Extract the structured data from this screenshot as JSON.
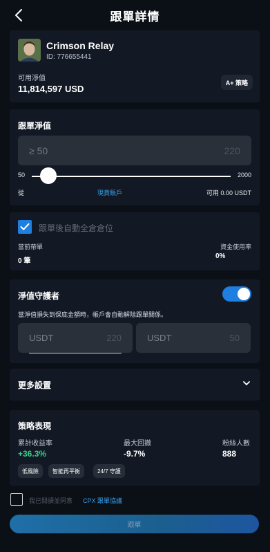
{
  "header": {
    "title": "跟單詳情"
  },
  "trader": {
    "name": "Crimson Relay",
    "id": "ID: 776655441",
    "equity_label": "可用淨值",
    "equity_value": "11,814,597 USD",
    "strategy_badge": "A+ 策略"
  },
  "copy_equity": {
    "title": "跟單淨值",
    "input_placeholder": "≥ 50",
    "input_max": "220",
    "slider_min": "50",
    "slider_max": "2000",
    "slider_value": 50,
    "from_label": "從",
    "spot_account": "現貨賬戶",
    "available": "可用 0.00 USDT"
  },
  "positions": {
    "auto_close_label": "跟單後自動全倉倉位",
    "auto_close_checked": true,
    "current_label": "當前帶單",
    "current_value": "0 筆",
    "util_label": "資金使用率",
    "util_value": "0%"
  },
  "guardian": {
    "title": "淨值守護者",
    "enabled": true,
    "description": "當淨值損失到保底金額時，帳戶會自動解除跟單關係。",
    "input1_placeholder": "USDT",
    "input1_value": "220",
    "input2_placeholder": "USDT",
    "input2_value": "50"
  },
  "more": {
    "label": "更多設置"
  },
  "performance": {
    "title": "策略表現",
    "return_label": "累計收益率",
    "return_value": "+36.3%",
    "drawdown_label": "最大回撤",
    "drawdown_value": "-9.7%",
    "followers_label": "粉絲人數",
    "followers_value": "888",
    "tags": [
      "低風險",
      "智能再平衡",
      "24/7 守護"
    ]
  },
  "agreement": {
    "text": "我已閱讀並同意",
    "link": "CPX 跟單協議",
    "checked": false
  },
  "follow_button": "跟單",
  "colors": {
    "accent": "#1e7fe0",
    "link": "#36a3ee",
    "positive": "#35d08a",
    "negative": "#ffffff"
  }
}
